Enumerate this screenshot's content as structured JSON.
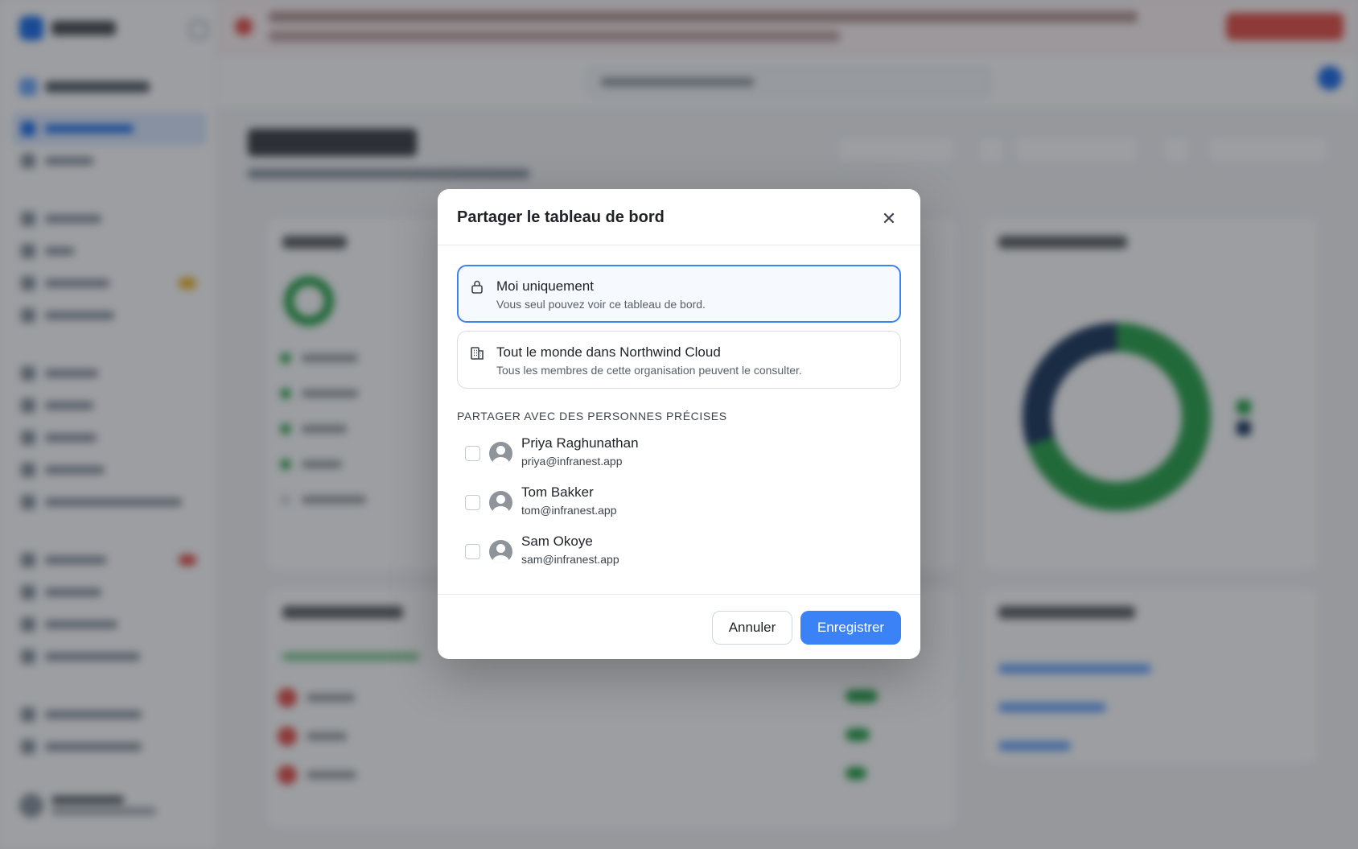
{
  "modal": {
    "title": "Partager le tableau de bord",
    "close_icon": "close-icon",
    "options": [
      {
        "icon": "lock-icon",
        "title": "Moi uniquement",
        "description": "Vous seul pouvez voir ce tableau de bord.",
        "selected": true
      },
      {
        "icon": "building-icon",
        "title": "Tout le monde dans Northwind Cloud",
        "description": "Tous les membres de cette organisation peuvent le consulter.",
        "selected": false
      }
    ],
    "people_section_label": "PARTAGER AVEC DES PERSONNES PRÉCISES",
    "people": [
      {
        "name": "Priya Raghunathan",
        "email": "priya@infranest.app",
        "checked": false
      },
      {
        "name": "Tom Bakker",
        "email": "tom@infranest.app",
        "checked": false
      },
      {
        "name": "Sam Okoye",
        "email": "sam@infranest.app",
        "checked": false
      }
    ],
    "cancel_label": "Annuler",
    "save_label": "Enregistrer"
  },
  "colors": {
    "accent": "#3b82f6",
    "overlay": "rgba(18, 24, 32, 0.42)",
    "success": "#2da44e",
    "danger": "#e5534b"
  }
}
